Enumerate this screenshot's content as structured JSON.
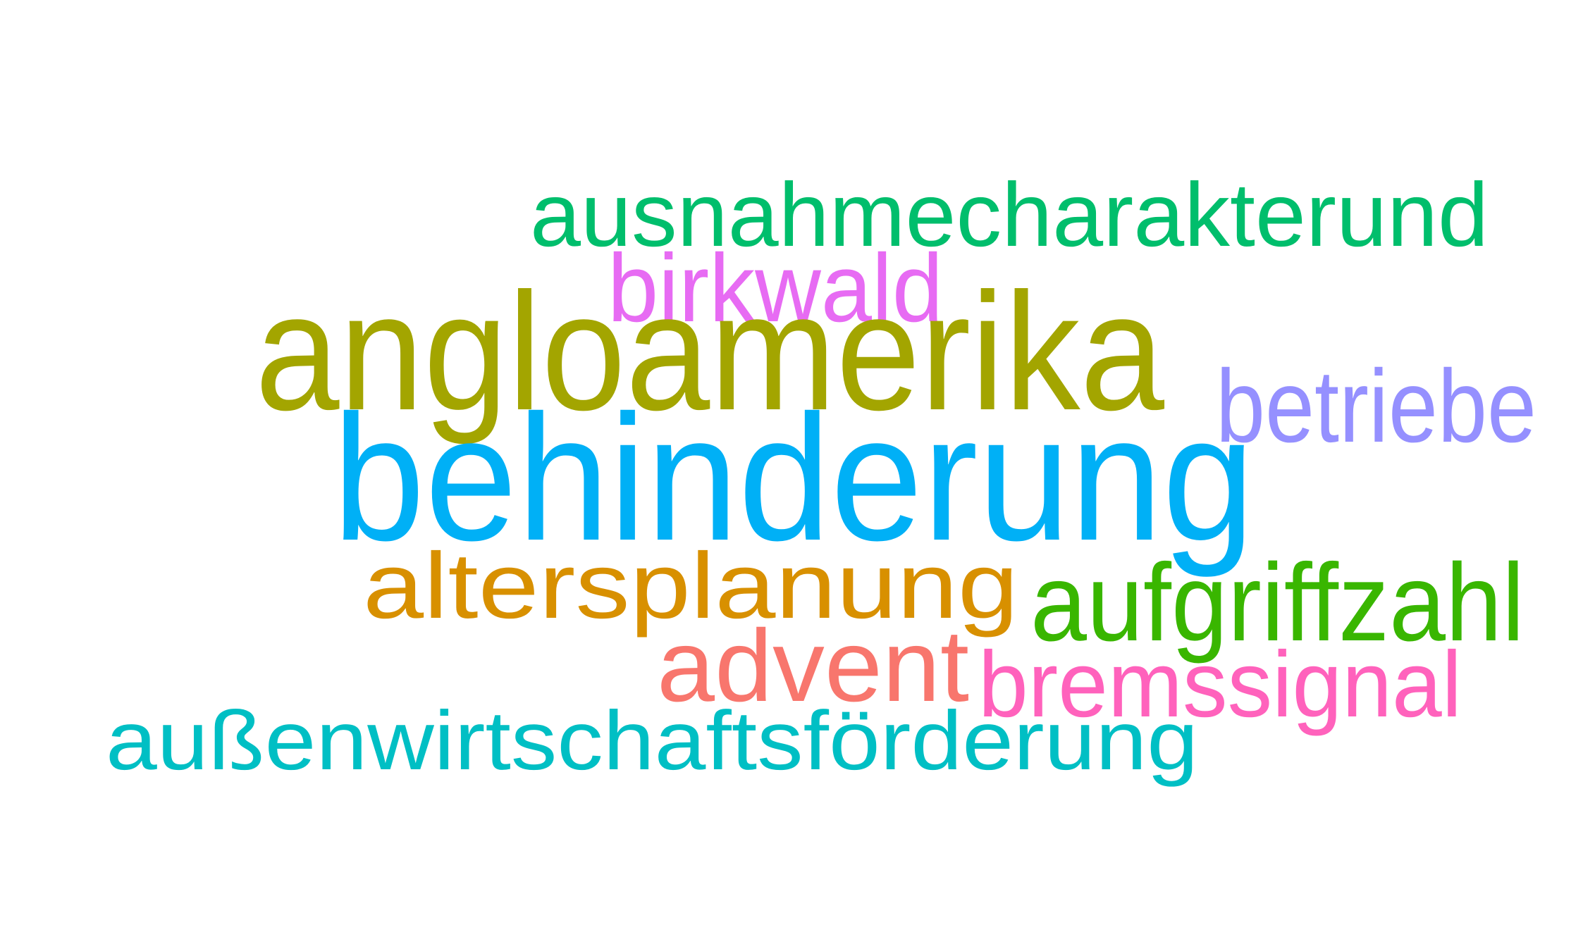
{
  "words": [
    {
      "text": "ausnahmecharakterund",
      "color": "#00BE6C"
    },
    {
      "text": "birkwald",
      "color": "#E76BF3"
    },
    {
      "text": "angloamerika",
      "color": "#A3A500"
    },
    {
      "text": "betriebe",
      "color": "#9590FF"
    },
    {
      "text": "behinderung",
      "color": "#00B0F6"
    },
    {
      "text": "altersplanung",
      "color": "#D89000"
    },
    {
      "text": "aufgriffzahl",
      "color": "#39B600"
    },
    {
      "text": "advent",
      "color": "#F8766D"
    },
    {
      "text": "bremssignal",
      "color": "#FF62BC"
    },
    {
      "text": "außenwirtschaftsförderung",
      "color": "#00BFC4"
    }
  ]
}
